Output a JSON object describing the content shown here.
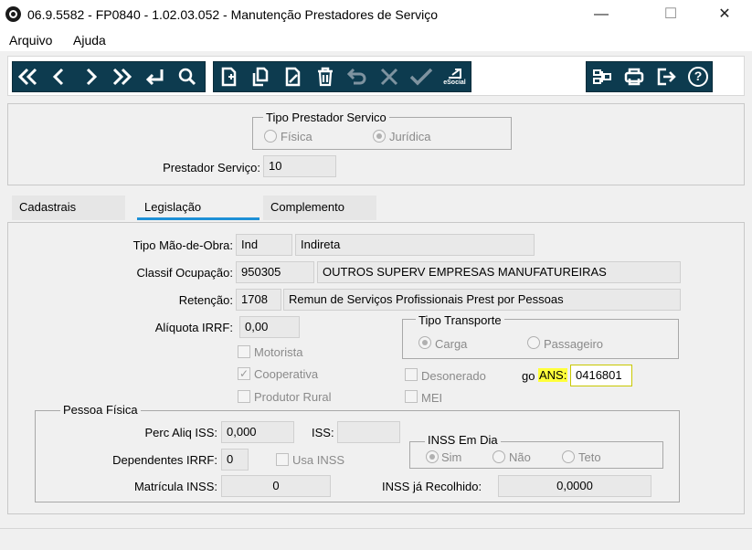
{
  "window": {
    "title": "06.9.5582 - FP0840 - 1.02.03.052 - Manutenção Prestadores de Serviço",
    "minimize": "—",
    "maximize": "☐",
    "close": "✕"
  },
  "menu": {
    "items": [
      "Arquivo",
      "Ajuda"
    ]
  },
  "toolbar": {
    "nav": [
      "first-icon",
      "previous-icon",
      "next-icon",
      "last-icon",
      "enter-icon",
      "search-icon"
    ],
    "edit": [
      "new-icon",
      "copy-icon",
      "edit-icon",
      "delete-icon",
      "undo-icon",
      "cancel-icon",
      "confirm-icon",
      "esocial-icon"
    ],
    "esocial_label": "eSocial",
    "right": [
      "hierarchy-icon",
      "print-icon",
      "exit-icon",
      "help-icon"
    ],
    "help_glyph": "?"
  },
  "tipo_prestador": {
    "legend": "Tipo Prestador Servico",
    "options": [
      "Física",
      "Jurídica"
    ],
    "selected": "Jurídica"
  },
  "prestador": {
    "label": "Prestador Serviço:",
    "value": "10"
  },
  "tabs": {
    "items": [
      "Cadastrais",
      "Legislação",
      "Complemento"
    ],
    "active": "Legislação"
  },
  "legislacao": {
    "tipo_mao_obra": {
      "label": "Tipo Mão-de-Obra:",
      "code": "Ind",
      "desc": "Indireta"
    },
    "classif_ocupacao": {
      "label": "Classif Ocupação:",
      "code": "950305",
      "desc": "OUTROS SUPERV EMPRESAS MANUFATUREIRAS"
    },
    "retencao": {
      "label": "Retenção:",
      "code": "1708",
      "desc": "Remun de Serviços Profissionais Prest por Pessoas"
    },
    "aliquota_irrf": {
      "label": "Alíquota IRRF:",
      "value": "0,00"
    },
    "checks": {
      "motorista": "Motorista",
      "cooperativa": "Cooperativa",
      "produtor_rural": "Produtor Rural",
      "desonerado": "Desonerado",
      "mei": "MEI"
    },
    "check_mark": "✓",
    "tipo_transporte": {
      "legend": "Tipo Transporte",
      "options": [
        "Carga",
        "Passageiro"
      ],
      "selected": "Carga"
    },
    "ans": {
      "prefix": "go",
      "label": "ANS:",
      "value": "0416801"
    }
  },
  "pessoa_fisica": {
    "legend": "Pessoa Física",
    "perc_aliq_iss": {
      "label": "Perc Aliq ISS:",
      "value": "0,000"
    },
    "iss": {
      "label": "ISS:",
      "value": ""
    },
    "dependentes_irrf": {
      "label": "Dependentes IRRF:",
      "value": "0"
    },
    "usa_inss": "Usa INSS",
    "matricula_inss": {
      "label": "Matrícula INSS:",
      "value": "0"
    },
    "inss_em_dia": {
      "legend": "INSS Em Dia",
      "options": [
        "Sim",
        "Não",
        "Teto"
      ],
      "selected": "Sim"
    },
    "inss_recolhido": {
      "label": "INSS já Recolhido:",
      "value": "0,0000"
    }
  },
  "colors": {
    "toolbar_bg": "#0d3b4f",
    "tab_active_underline": "#1e90d6",
    "highlight": "#ffff3a"
  }
}
